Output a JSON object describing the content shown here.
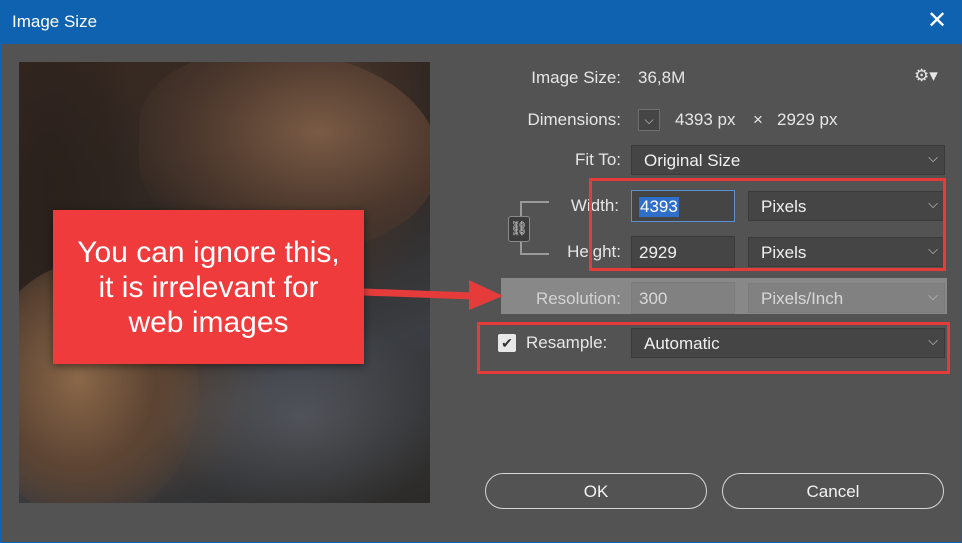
{
  "window": {
    "title": "Image Size",
    "close_symbol": "✕"
  },
  "info": {
    "image_size_label": "Image Size:",
    "image_size_value": "36,8M",
    "dimensions_label": "Dimensions:",
    "dimensions_width": "4393 px",
    "dimensions_times": "×",
    "dimensions_height": "2929 px"
  },
  "fit_to": {
    "label": "Fit To:",
    "value": "Original Size"
  },
  "width": {
    "label": "Width:",
    "value": "4393",
    "unit": "Pixels"
  },
  "height": {
    "label": "Height:",
    "value": "2929",
    "unit": "Pixels"
  },
  "resolution": {
    "label": "Resolution:",
    "value": "300",
    "unit": "Pixels/Inch"
  },
  "resample": {
    "label": "Resample:",
    "checked": true,
    "value": "Automatic"
  },
  "annotation": {
    "callout_text": "You can ignore this,\nit is irrelevant for\nweb images"
  },
  "buttons": {
    "ok": "OK",
    "cancel": "Cancel"
  },
  "icons": {
    "gear": "gear-icon",
    "chevron": "chevron-down-icon",
    "link": "link-icon",
    "checkbox": "checkbox-checked-icon"
  },
  "colors": {
    "titlebar": "#0f62b0",
    "dialog_bg": "#535353",
    "callout": "#ef3b3b",
    "highlight_box": "#e53b3b",
    "selection": "#2f6fc9"
  }
}
